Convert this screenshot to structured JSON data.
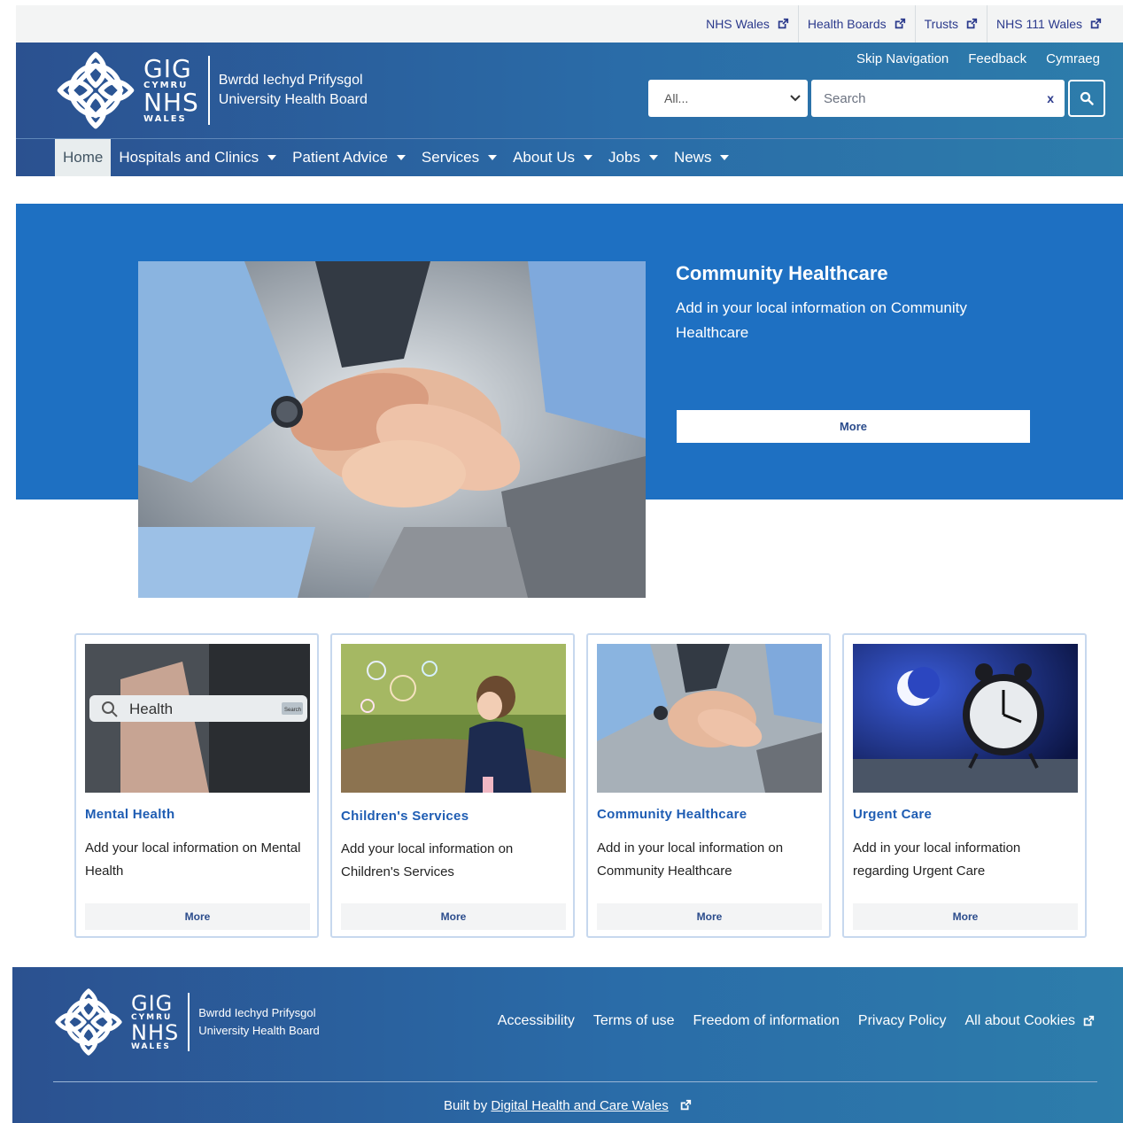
{
  "utility_links": [
    {
      "label": "NHS Wales"
    },
    {
      "label": "Health Boards"
    },
    {
      "label": "Trusts"
    },
    {
      "label": "NHS 111 Wales"
    }
  ],
  "logo": {
    "gig": "GIG",
    "cymru": "CYMRU",
    "nhs": "NHS",
    "wales": "WALES",
    "board_welsh": "Bwrdd Iechyd Prifysgol",
    "board_english": "University Health Board"
  },
  "header_links": {
    "skip": "Skip Navigation",
    "feedback": "Feedback",
    "language": "Cymraeg"
  },
  "search": {
    "scope_value": "All...",
    "placeholder": "Search",
    "clear": "x"
  },
  "nav": [
    {
      "label": "Home",
      "active": true
    },
    {
      "label": "Hospitals and Clinics",
      "dropdown": true
    },
    {
      "label": "Patient Advice",
      "dropdown": true
    },
    {
      "label": "Services",
      "dropdown": true
    },
    {
      "label": "About Us",
      "dropdown": true
    },
    {
      "label": "Jobs",
      "dropdown": true
    },
    {
      "label": "News",
      "dropdown": true
    }
  ],
  "hero": {
    "title": "Community Healthcare",
    "description": "Add in your local information on Community Healthcare",
    "button": "More"
  },
  "cards": [
    {
      "title": "Mental Health",
      "description": "Add your local information on Mental Health",
      "button": "More",
      "image_text": "Health",
      "image_button": "Search"
    },
    {
      "title": "Children's Services",
      "description": "Add your local information on Children's Services",
      "button": "More"
    },
    {
      "title": "Community Healthcare",
      "description": "Add in your local information on Community Healthcare",
      "button": "More"
    },
    {
      "title": "Urgent Care",
      "description": "Add in your local information regarding Urgent Care",
      "button": "More"
    }
  ],
  "footer": {
    "links": [
      "Accessibility",
      "Terms of use",
      "Freedom of information",
      "Privacy Policy",
      "All about Cookies"
    ],
    "built_by_prefix": "Built by",
    "built_by_link": "Digital Health and Care Wales"
  },
  "colors": {
    "brand_blue": "#1e70c2",
    "header_gradient_start": "#2b5190",
    "header_gradient_end": "#2d7dab",
    "link_blue": "#1f5db3"
  }
}
